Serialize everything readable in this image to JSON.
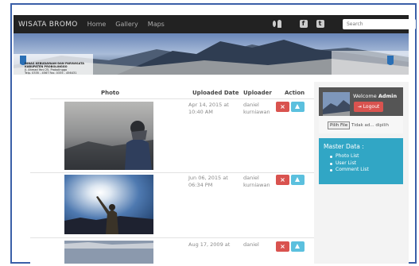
{
  "navbar": {
    "brand": "WISATA BROMO",
    "links": [
      "Home",
      "Gallery",
      "Maps"
    ],
    "search_placeholder": "Search"
  },
  "banner": {
    "left_text": [
      "DINAS KEBUDAYAAN DAN PARIWISATA",
      "KABUPATEN PROBOLINGGO",
      "Jl. Ahmad Yani 25, Probolinggo",
      "Telp. 0335 - 4567 Fax. 0335 - 456431"
    ]
  },
  "table": {
    "headers": {
      "photo": "Photo",
      "uploaded": "Uploaded Date",
      "uploader": "Uploader",
      "action": "Action"
    },
    "rows": [
      {
        "date": "Apr 14, 2015 at 10:40 AM",
        "uploader": "daniel kurniawan"
      },
      {
        "date": "Jun 06, 2015 at 06:34 PM",
        "uploader": "daniel kurniawan"
      },
      {
        "date": "Aug 17, 2009 at",
        "uploader": "daniel"
      }
    ],
    "delete_label": "×"
  },
  "sidebar": {
    "welcome_prefix": "Welcome ",
    "welcome_user": "Admin",
    "logout_label": "Logout",
    "file_button": "Pilih File",
    "file_status": "Tidak ad... dipilih",
    "master_title": "Master Data :",
    "master_items": [
      "Photo List",
      "User List",
      "Comment List"
    ]
  },
  "colors": {
    "navbar": "#222222",
    "delete": "#d9534f",
    "upload": "#5bc0de",
    "master": "#31a6c5",
    "frame": "#3a5fa8"
  }
}
